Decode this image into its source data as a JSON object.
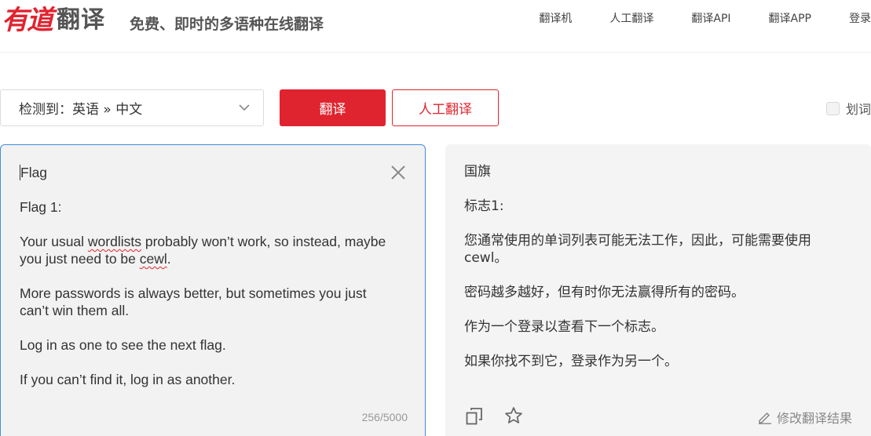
{
  "header": {
    "logo_brand": "有道",
    "logo_name": "翻译",
    "slogan": "免费、即时的多语种在线翻译",
    "nav": [
      "翻译机",
      "人工翻译",
      "翻译API",
      "翻译APP",
      "登录"
    ]
  },
  "toolbar": {
    "lang_select": "检测到：英语 » 中文",
    "translate_label": "翻译",
    "human_label": "人工翻译",
    "huaci_label": "划词"
  },
  "source": {
    "line_title": "Flag",
    "line_flag": "Flag 1:",
    "p1_a": "Your usual ",
    "p1_word": "wordlists",
    "p1_b": " probably won’t work, so instead, maybe you just need to be ",
    "p1_cewl": "cewl",
    "p1_c": ".",
    "p2": "More passwords is always better, but sometimes you just can’t win them all.",
    "p3": "Log in as one to see the next flag.",
    "p4": "If you can’t find it, log in as another.",
    "counter": "256/5000"
  },
  "target": {
    "l1": "国旗",
    "l2": "标志1:",
    "l3": "您通常使用的单词列表可能无法工作，因此，可能需要使用cewl。",
    "l4": "密码越多越好，但有时你无法赢得所有的密码。",
    "l5": "作为一个登录以查看下一个标志。",
    "l6": "如果你找不到它，登录作为另一个。",
    "edit_label": "修改翻译结果"
  },
  "colors": {
    "accent": "#e0242f",
    "focus_border": "#3d8ee0"
  }
}
